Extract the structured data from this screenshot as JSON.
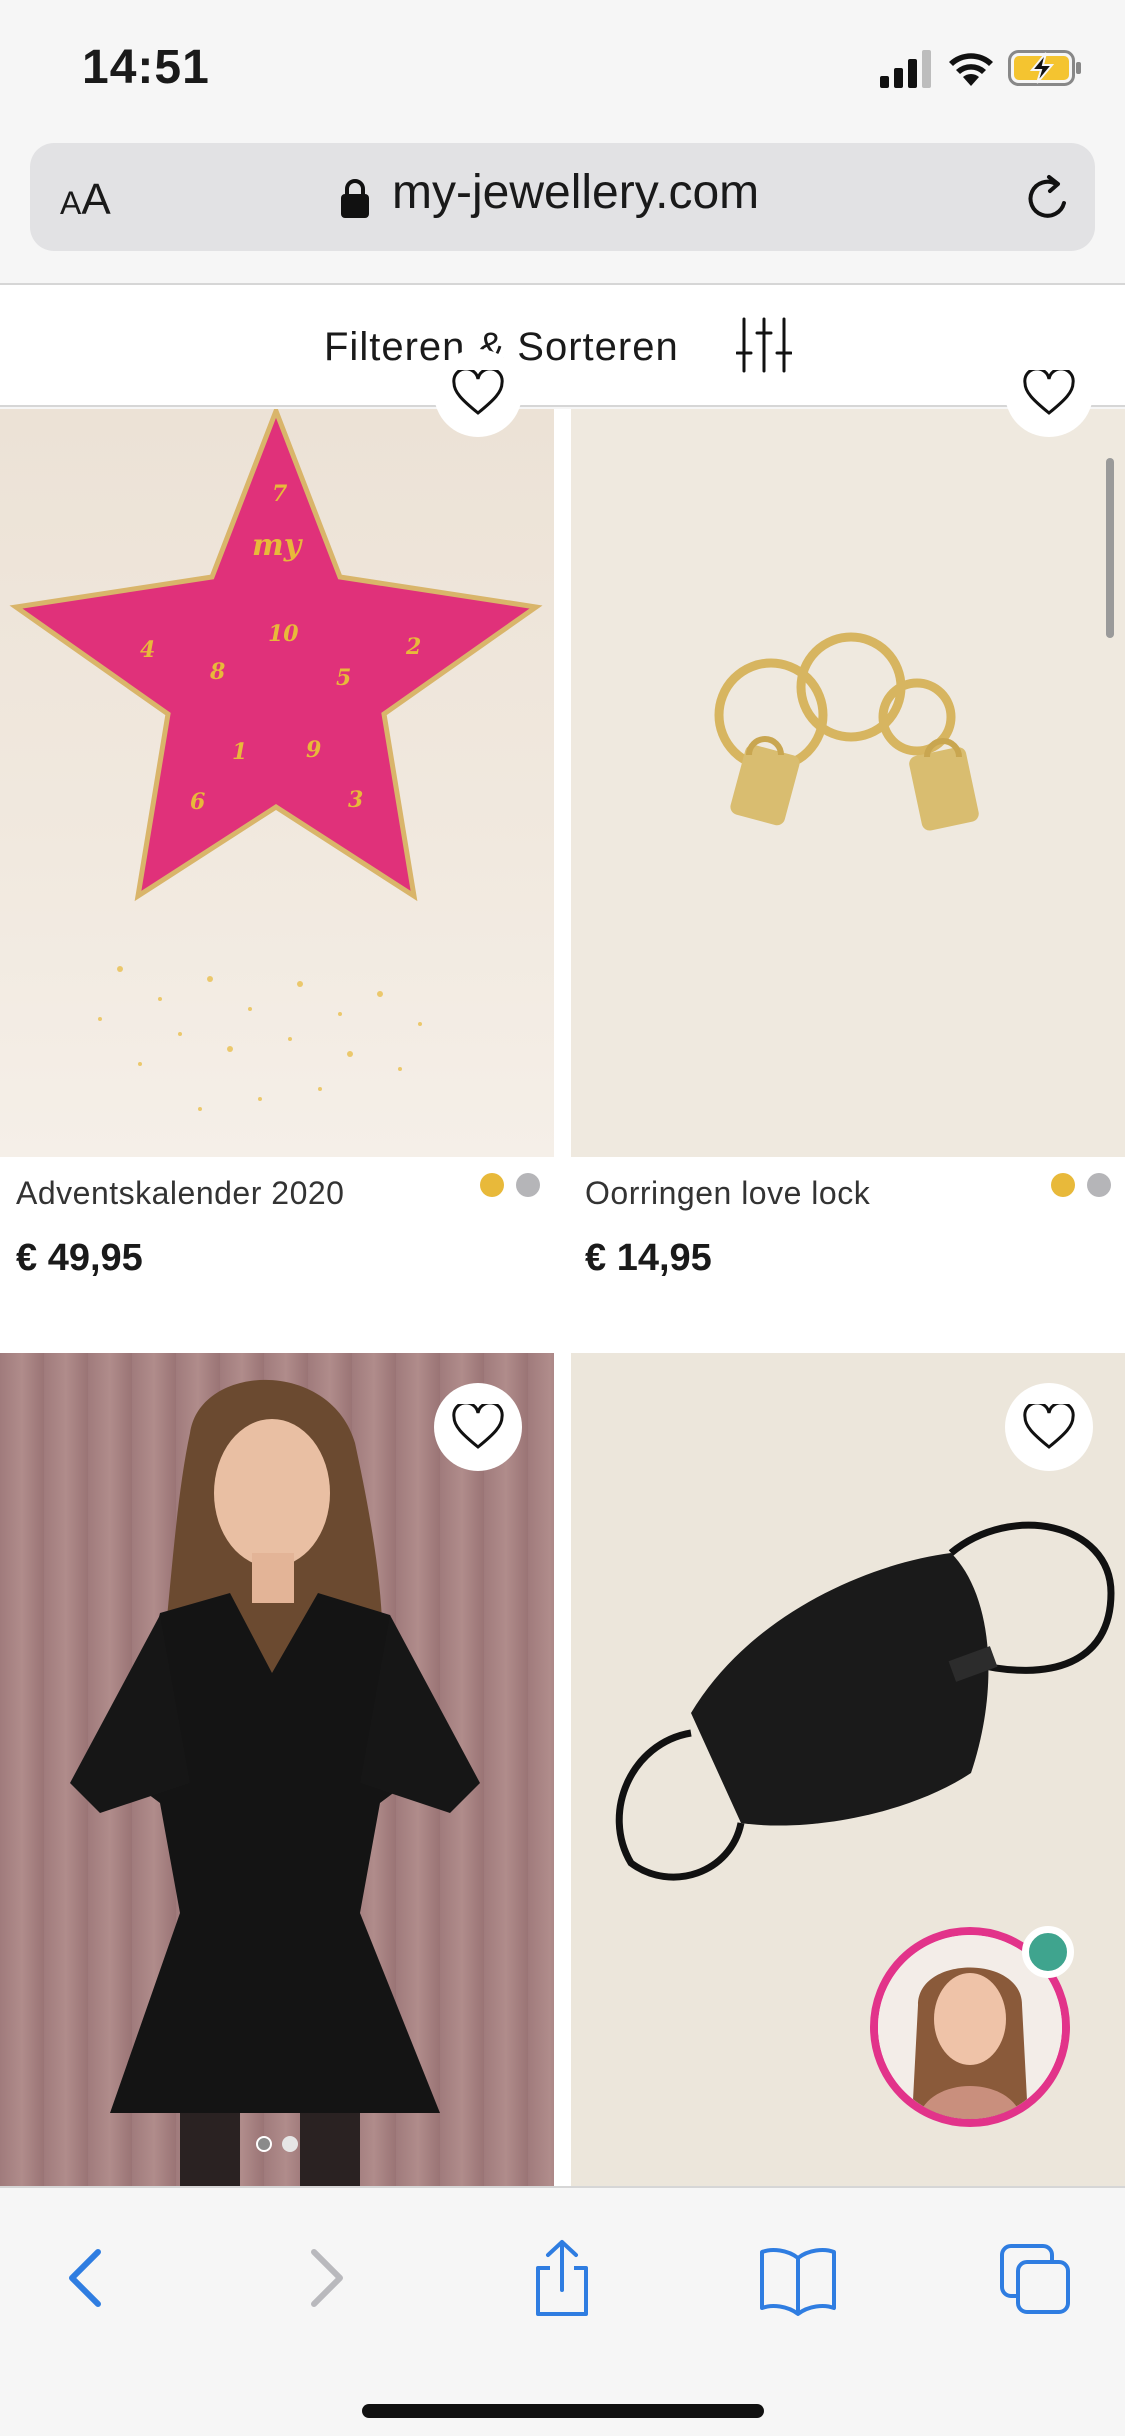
{
  "status_bar": {
    "time": "14:51",
    "battery_color": "#f4c430"
  },
  "browser": {
    "text_size_label": "AA",
    "url": "my-jewellery.com"
  },
  "filter": {
    "label": "Filteren & Sorteren"
  },
  "products": [
    {
      "name": "Adventskalender 2020",
      "price": "€ 49,95",
      "swatches": [
        "#e8b93a",
        "#b5b5b8"
      ]
    },
    {
      "name": "Oorringen love lock",
      "price": "€ 14,95",
      "swatches": [
        "#e8b93a",
        "#b5b5b8"
      ]
    },
    {
      "name": "",
      "price": ""
    },
    {
      "name": "",
      "price": ""
    }
  ],
  "calendar_numbers": [
    "7",
    "10",
    "4",
    "8",
    "2",
    "5",
    "1",
    "9",
    "6",
    "3"
  ],
  "calendar_brand": "my",
  "colors": {
    "accent_pink": "#e2338a",
    "online_green": "#3fa48e",
    "ios_blue": "#2f7de1"
  }
}
